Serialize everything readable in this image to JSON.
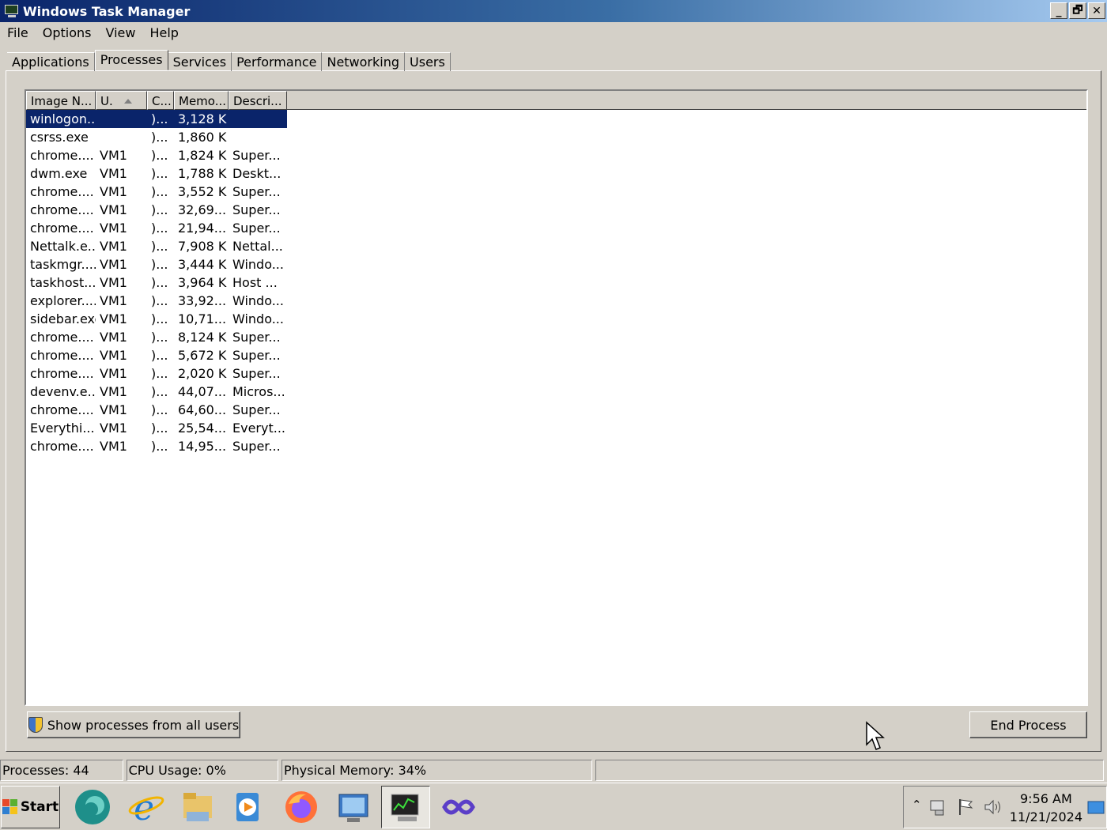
{
  "window": {
    "title": "Windows Task Manager",
    "controls": {
      "minimize": "_",
      "restore": "🗗",
      "close": "✕"
    }
  },
  "menu": [
    "File",
    "Options",
    "View",
    "Help"
  ],
  "tabs": [
    "Applications",
    "Processes",
    "Services",
    "Performance",
    "Networking",
    "Users"
  ],
  "active_tab": "Processes",
  "columns": [
    "Image N...",
    "U.",
    "C...",
    "Memo...",
    "Descri..."
  ],
  "sort_column": "U.",
  "processes": [
    [
      "winlogon...",
      "",
      ")...",
      "3,128 K",
      ""
    ],
    [
      "csrss.exe",
      "",
      ")...",
      "1,860 K",
      ""
    ],
    [
      "chrome....",
      "VM1",
      ")...",
      "1,824 K",
      "Super..."
    ],
    [
      "dwm.exe",
      "VM1",
      ")...",
      "1,788 K",
      "Deskt..."
    ],
    [
      "chrome....",
      "VM1",
      ")...",
      "3,552 K",
      "Super..."
    ],
    [
      "chrome....",
      "VM1",
      ")...",
      "32,69...",
      "Super..."
    ],
    [
      "chrome....",
      "VM1",
      ")...",
      "21,94...",
      "Super..."
    ],
    [
      "Nettalk.e...",
      "VM1",
      ")...",
      "7,908 K",
      "Nettal..."
    ],
    [
      "taskmgr....",
      "VM1",
      ")...",
      "3,444 K",
      "Windo..."
    ],
    [
      "taskhost....",
      "VM1",
      ")...",
      "3,964 K",
      "Host ..."
    ],
    [
      "explorer....",
      "VM1",
      ")...",
      "33,92...",
      "Windo..."
    ],
    [
      "sidebar.exe",
      "VM1",
      ")...",
      "10,71...",
      "Windo..."
    ],
    [
      "chrome....",
      "VM1",
      ")...",
      "8,124 K",
      "Super..."
    ],
    [
      "chrome....",
      "VM1",
      ")...",
      "5,672 K",
      "Super..."
    ],
    [
      "chrome....",
      "VM1",
      ")...",
      "2,020 K",
      "Super..."
    ],
    [
      "devenv.e...",
      "VM1",
      ")...",
      "44,07...",
      "Micros..."
    ],
    [
      "chrome....",
      "VM1",
      ")...",
      "64,60...",
      "Super..."
    ],
    [
      "Everythi...",
      "VM1",
      ")...",
      "25,54...",
      "Everyt..."
    ],
    [
      "chrome....",
      "VM1",
      ")...",
      "14,95...",
      "Super..."
    ]
  ],
  "selected_row": 0,
  "buttons": {
    "show_all": "Show processes from all users",
    "end_process": "End Process"
  },
  "status": {
    "processes": "Processes: 44",
    "cpu": "CPU Usage: 0%",
    "memory": "Physical Memory: 34%"
  },
  "taskbar": {
    "start_label": "Start",
    "apps": [
      "edge-legacy-icon",
      "internet-explorer-icon",
      "file-explorer-icon",
      "media-player-icon",
      "firefox-icon",
      "control-panel-icon",
      "task-manager-icon",
      "visual-studio-icon"
    ],
    "active_app": "task-manager-icon",
    "clock_time": "9:56 AM",
    "clock_date": "11/21/2024"
  },
  "colors": {
    "selection": "#0a246a",
    "titlebar_start": "#0a246a",
    "titlebar_end": "#a6caf0",
    "face": "#d4d0c8"
  }
}
